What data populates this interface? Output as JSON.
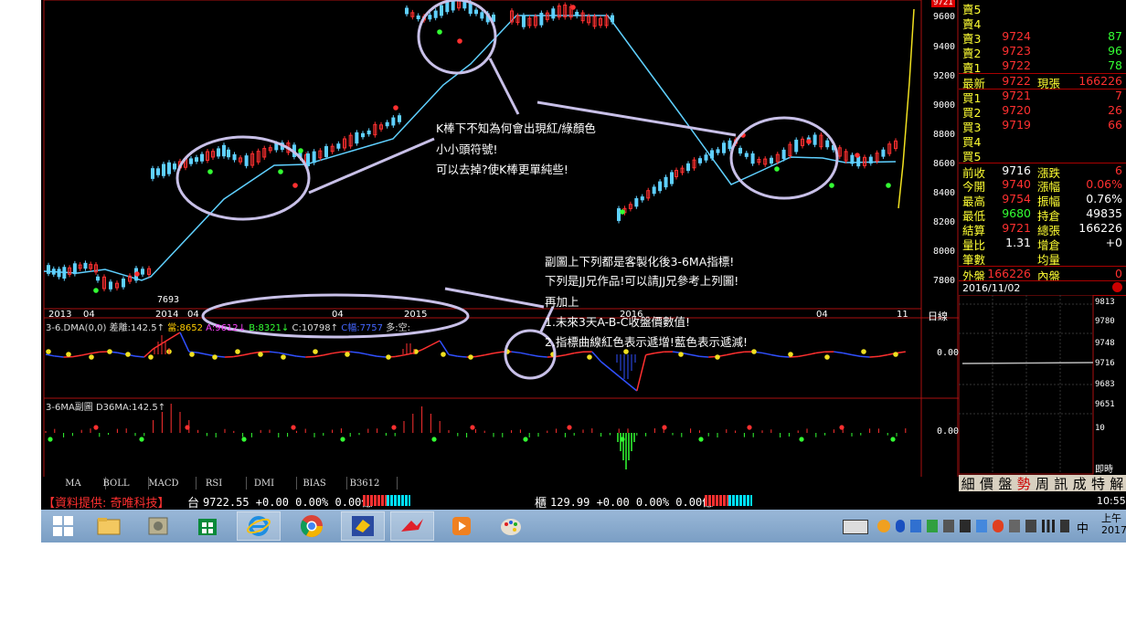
{
  "main_chart": {
    "price_axis": [
      "9600",
      "9400",
      "9200",
      "9000",
      "8800",
      "8600",
      "8400",
      "8200",
      "8000",
      "7800"
    ],
    "top_price_tag": "9721",
    "low_label": "7693",
    "date_axis": [
      "2013",
      "04",
      "2014",
      "04",
      "2015",
      "04",
      "2016",
      "04",
      "11"
    ],
    "period_button": "日線"
  },
  "annotations": {
    "note1_line1": "K棒下不知為何會出現紅/綠顏色",
    "note1_line2": "小小頭符號!",
    "note1_line3": "可以去掉?使K棒更單純些!",
    "note2_line1": "副圖上下列都是客製化後3-6MA指標!",
    "note2_line2": "下列是JJ兄作品!可以請JJ兄參考上列圖!",
    "note2_line3": "再加上",
    "note2_line4": "1.未來3天A-B-C收盤價數值!",
    "note2_line5": "2.指標曲線紅色表示遞增!藍色表示遞減!"
  },
  "sub1": {
    "title": "3-6.DMA(0,0)",
    "diff": "差離:142.5↑",
    "cur": "當:8652",
    "a": "A:9612↓",
    "b": "B:8321↓",
    "c": "C:10798↑",
    "hidden": "C幅:7757",
    "longshort": "多:空:",
    "axis_zero": "0.00"
  },
  "sub2": {
    "title": "3-6MA副圖 D36MA:142.5↑",
    "axis_zero": "0.00"
  },
  "bottom_tabs": [
    "MA",
    "BOLL",
    "MACD",
    "RSI",
    "DMI",
    "BIAS",
    "B3612"
  ],
  "quote": {
    "sell5": "賣5",
    "sell4": "賣4",
    "sell3": {
      "label": "賣3",
      "price": "9724",
      "vol": "87"
    },
    "sell2": {
      "label": "賣2",
      "price": "9723",
      "vol": "96"
    },
    "sell1": {
      "label": "賣1",
      "price": "9722",
      "vol": "78"
    },
    "last": {
      "label": "最新",
      "price": "9722",
      "label2": "現張",
      "vol": "166226"
    },
    "buy1": {
      "label": "買1",
      "price": "9721",
      "vol": "7"
    },
    "buy2": {
      "label": "買2",
      "price": "9720",
      "vol": "26"
    },
    "buy3": {
      "label": "買3",
      "price": "9719",
      "vol": "66"
    },
    "buy4": "買4",
    "buy5": "買5",
    "prev": {
      "label": "前收",
      "value": "9716",
      "label2": "漲跌",
      "value2": "6"
    },
    "open": {
      "label": "今開",
      "value": "9740",
      "label2": "漲幅",
      "value2": "0.06%"
    },
    "high": {
      "label": "最高",
      "value": "9754",
      "label2": "振幅",
      "value2": "0.76%"
    },
    "low": {
      "label": "最低",
      "value": "9680",
      "label2": "持倉",
      "value2": "49835"
    },
    "settle": {
      "label": "結算",
      "value": "9721",
      "label2": "總張",
      "value2": "166226"
    },
    "ratio": {
      "label": "量比",
      "value": "1.31",
      "label2": "增倉",
      "value2": "+0"
    },
    "count": {
      "label": "筆數",
      "label2": "均量"
    },
    "outer": {
      "label": "外盤",
      "value": "166226",
      "label2": "內盤",
      "value2": "0"
    },
    "date": "2016/11/02"
  },
  "intraday_axis": [
    "9813",
    "9780",
    "9748",
    "9716",
    "9683",
    "9651",
    "10"
  ],
  "intraday_label": "即時",
  "info_tabs": [
    "細",
    "價",
    "盤",
    "勢",
    "周",
    "訊",
    "成",
    "特",
    "解"
  ],
  "status": {
    "provider": "【資料提供: 奇唯科技】",
    "tw_label": "台",
    "tw_value": "9722.55 +0.00 0.00% 0.00億",
    "otc_label": "櫃",
    "otc_value": "129.99 +0.00 0.00% 0.00億",
    "clock": "10:55"
  },
  "taskbar": {
    "ampm": "上午",
    "year": "2017",
    "ime": "中"
  }
}
